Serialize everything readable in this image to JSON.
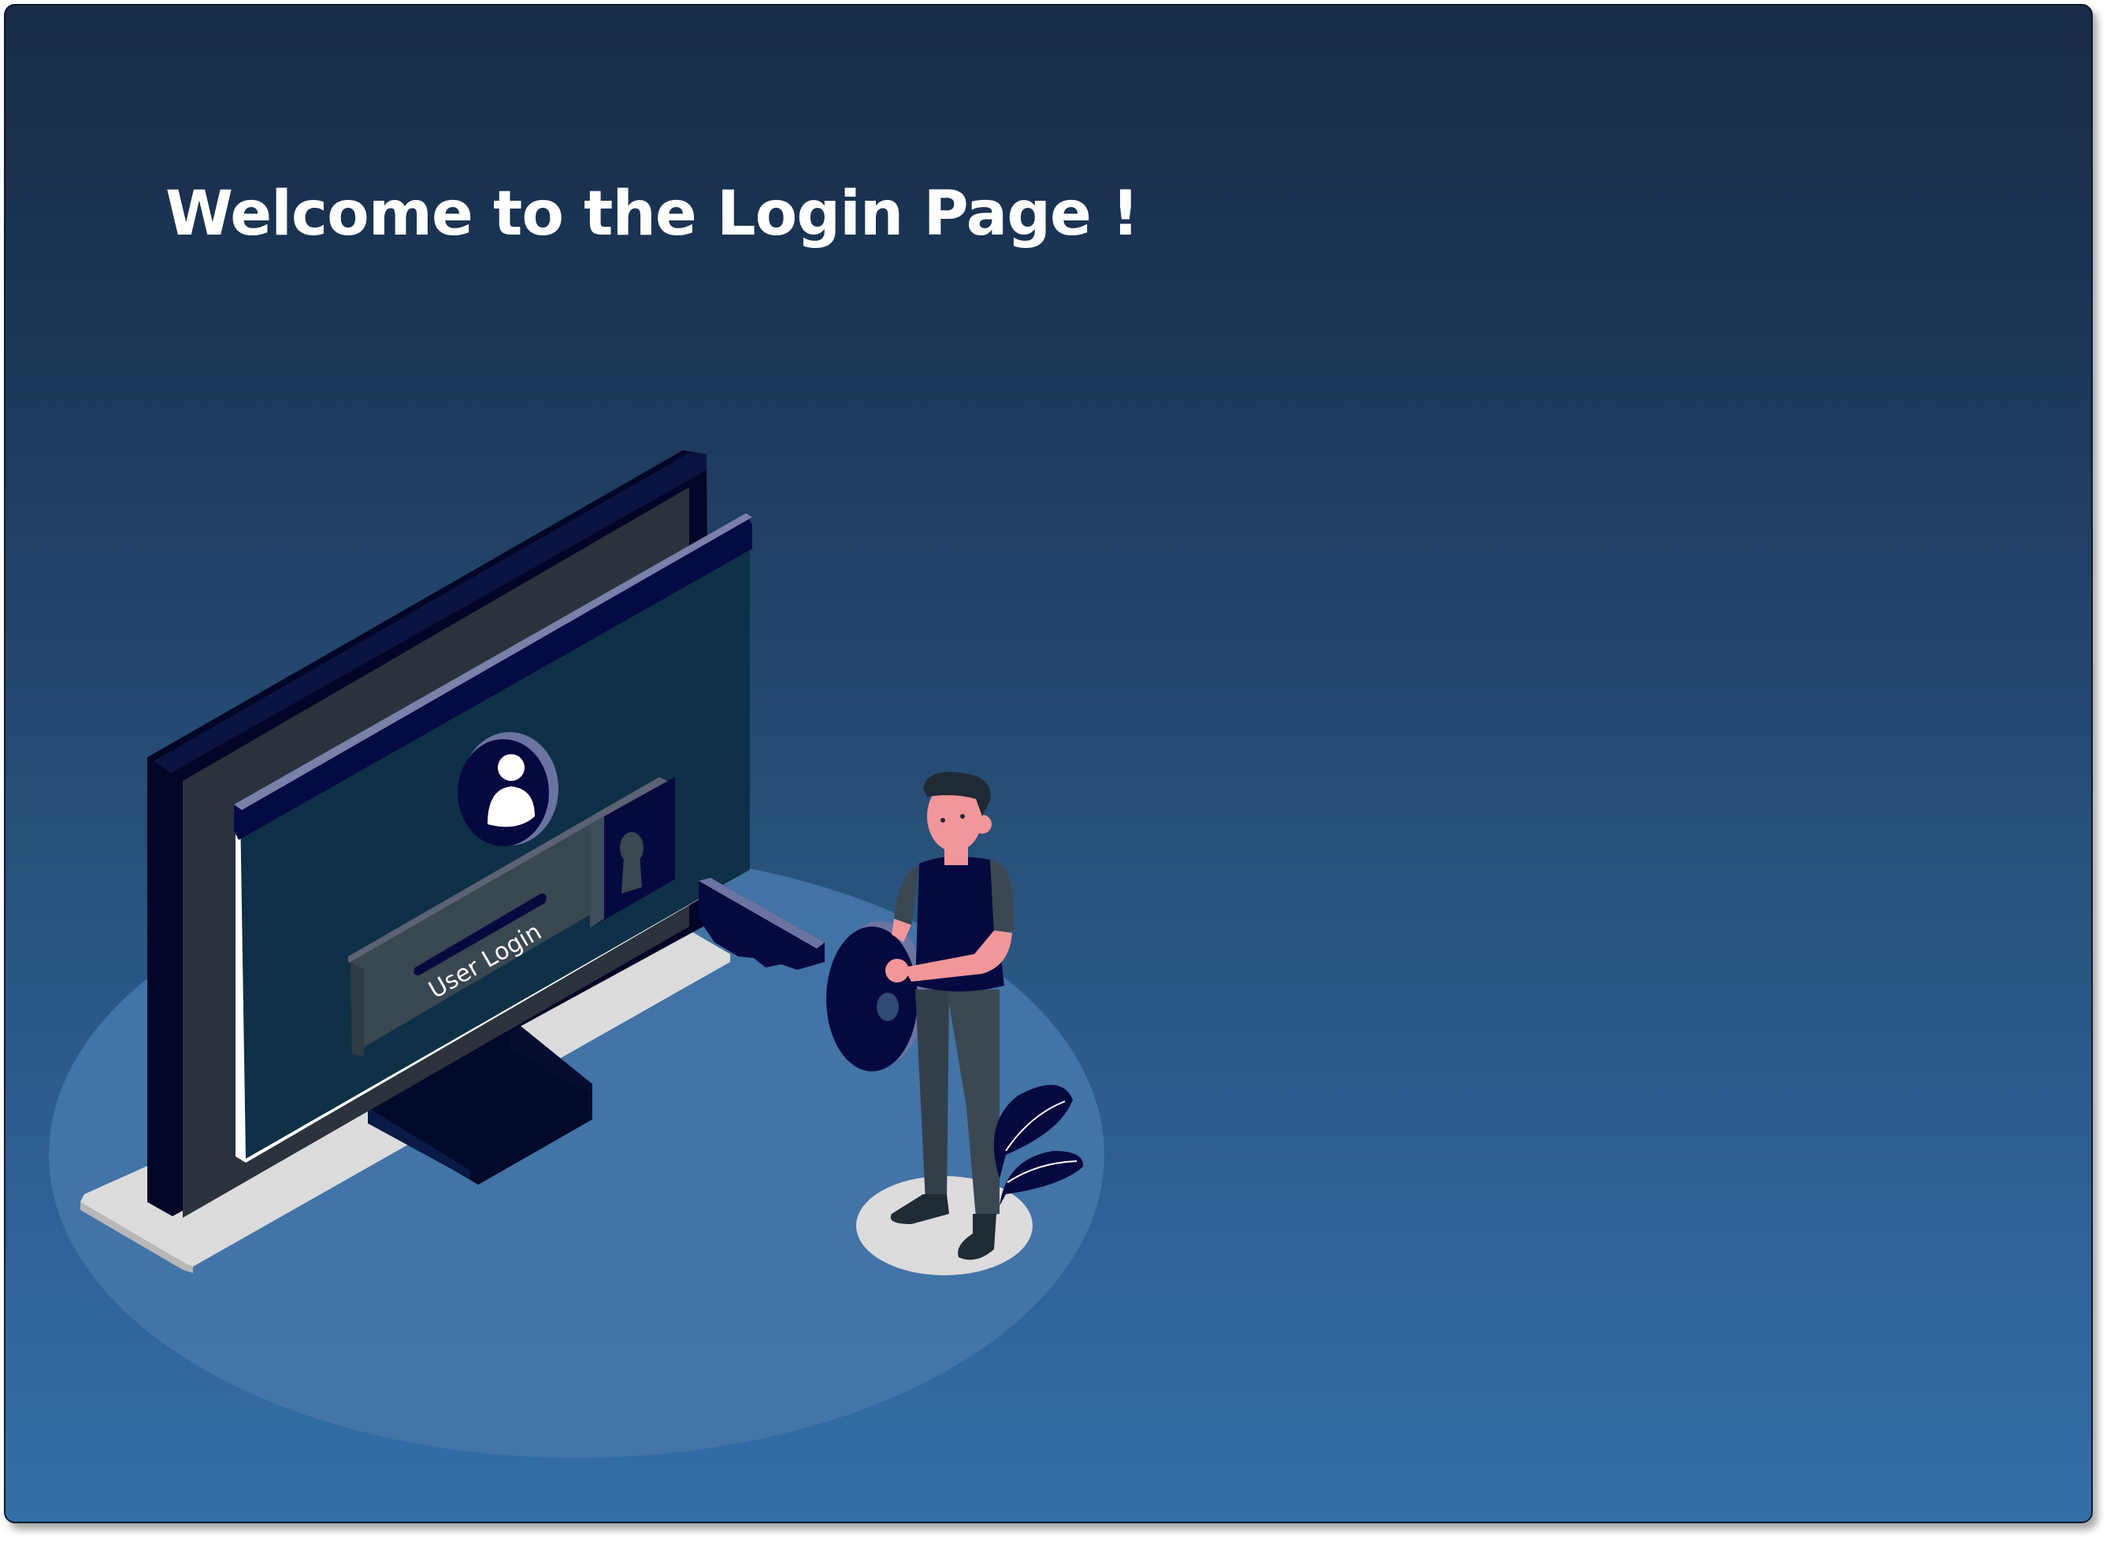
{
  "header": {
    "title": "Welcome to the Login Page !"
  },
  "illustration": {
    "field_label": "User Login",
    "icons": [
      "user-avatar-icon",
      "keyhole-icon",
      "key-icon",
      "person-figure",
      "leaf-plant-icon"
    ]
  },
  "colors": {
    "background_top": "#172b47",
    "background_bottom": "#346fa8",
    "platform": "#4577a8",
    "monitor_frame": "#0c1530",
    "screen": "#0f3247",
    "accent_navy": "#06093f",
    "accent_lavender": "#6b74a0"
  }
}
